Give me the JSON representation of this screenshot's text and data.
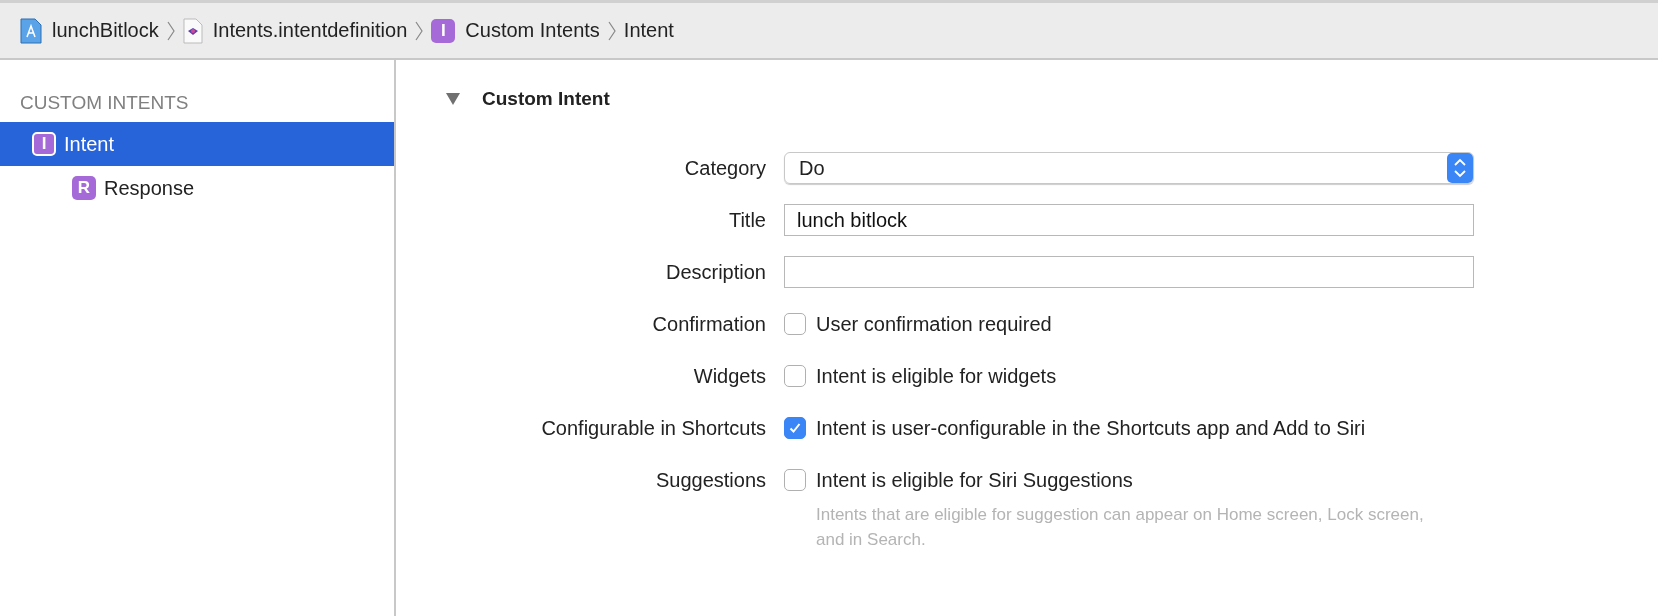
{
  "breadcrumbs": [
    {
      "label": "lunchBitlock",
      "kind": "project"
    },
    {
      "label": "Intents.intentdefinition",
      "kind": "file"
    },
    {
      "label": "Custom Intents",
      "kind": "intent",
      "badge": "I"
    },
    {
      "label": "Intent",
      "kind": "plain"
    }
  ],
  "sidebar": {
    "header": "CUSTOM INTENTS",
    "items": [
      {
        "label": "Intent",
        "badge": "I",
        "selected": true,
        "children": [
          {
            "label": "Response",
            "badge": "R",
            "selected": false
          }
        ]
      }
    ]
  },
  "section": {
    "title": "Custom Intent",
    "expanded": true
  },
  "form": [
    {
      "kind": "popup",
      "label": "Category",
      "value": "Do"
    },
    {
      "kind": "text",
      "label": "Title",
      "value": "lunch bitlock"
    },
    {
      "kind": "text",
      "label": "Description"
    },
    {
      "kind": "checkbox",
      "label": "Confirmation",
      "text": "User confirmation required",
      "checked": false
    },
    {
      "kind": "checkbox",
      "label": "Widgets",
      "text": "Intent is eligible for widgets",
      "checked": false
    },
    {
      "kind": "checkbox",
      "label": "Configurable in Shortcuts",
      "text": "Intent is user-configurable in the Shortcuts app and Add to Siri",
      "checked": true
    },
    {
      "kind": "checkbox",
      "label": "Suggestions",
      "text": "Intent is eligible for Siri Suggestions",
      "checked": false,
      "hint": "Intents that are eligible for suggestion can appear on Home screen, Lock screen, and in Search."
    }
  ]
}
